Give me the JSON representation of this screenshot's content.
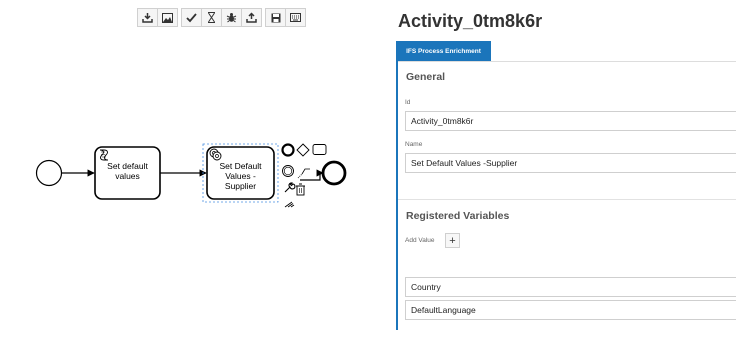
{
  "toolbar": {
    "groups": [
      [
        "download-icon",
        "image-icon"
      ],
      [
        "check-icon",
        "hourglass-icon",
        "bug-icon",
        "upload-icon"
      ],
      [
        "save-icon",
        "keyboard-icon"
      ]
    ]
  },
  "diagram": {
    "task1_label": "Set default values",
    "task2_label": "Set Default Values -Supplier"
  },
  "panel": {
    "title": "Activity_0tm8k6r",
    "tab_label": "IFS Process Enrichment",
    "general_heading": "General",
    "id_label": "Id",
    "id_value": "Activity_0tm8k6r",
    "name_label": "Name",
    "name_value": "Set Default Values -Supplier",
    "registered_heading": "Registered Variables",
    "add_value_label": "Add Value",
    "add_button": "+",
    "variables": [
      "Country",
      "DefaultLanguage"
    ]
  },
  "colors": {
    "accent": "#1b75bb",
    "selection": "#4a90e2"
  }
}
